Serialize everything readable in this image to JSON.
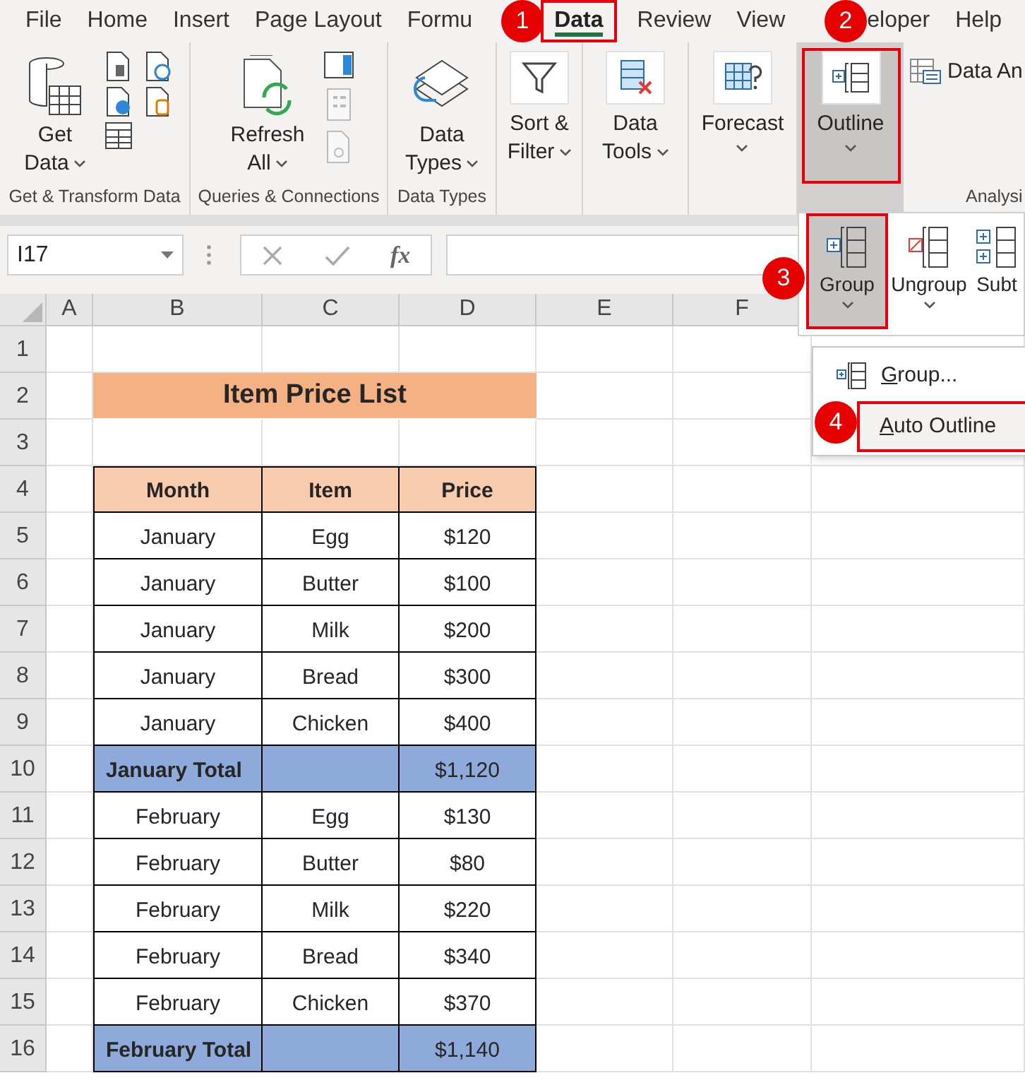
{
  "menu_tabs": [
    {
      "label": "File",
      "selected": false,
      "annotated": false
    },
    {
      "label": "Home",
      "selected": false,
      "annotated": false
    },
    {
      "label": "Insert",
      "selected": false,
      "annotated": false
    },
    {
      "label": "Page Layout",
      "selected": false,
      "annotated": false
    },
    {
      "label": "Formu",
      "selected": false,
      "annotated": false
    },
    {
      "label": "Data",
      "selected": true,
      "annotated": true,
      "callout": "1"
    },
    {
      "label": "Review",
      "selected": false,
      "annotated": false
    },
    {
      "label": "View",
      "selected": false,
      "annotated": false
    },
    {
      "label": "eloper",
      "selected": false,
      "annotated": false
    },
    {
      "label": "Help",
      "selected": false,
      "annotated": false
    }
  ],
  "ribbon": {
    "groups": [
      {
        "kind": "get_transform",
        "label": "Get & Transform Data",
        "button": {
          "lines": [
            "Get",
            "Data"
          ],
          "dropdown": true,
          "pressed": false,
          "annotated": false
        }
      },
      {
        "kind": "queries",
        "label": "Queries & Connections",
        "button": {
          "lines": [
            "Refresh",
            "All"
          ],
          "dropdown": true,
          "pressed": false,
          "annotated": false
        }
      },
      {
        "kind": "data_types",
        "label": "Data Types",
        "button": {
          "lines": [
            "Data",
            "Types"
          ],
          "dropdown": true,
          "pressed": false,
          "annotated": false
        }
      },
      {
        "kind": "sort_filter",
        "button": {
          "lines": [
            "Sort &",
            "Filter"
          ],
          "dropdown": true,
          "pressed": false,
          "annotated": false
        }
      },
      {
        "kind": "data_tools",
        "button": {
          "lines": [
            "Data",
            "Tools"
          ],
          "dropdown": true,
          "pressed": false,
          "annotated": false
        }
      },
      {
        "kind": "forecast",
        "button": {
          "lines": [
            "Forecast"
          ],
          "dropdown": true,
          "pressed": false,
          "annotated": false
        }
      },
      {
        "kind": "outline",
        "button": {
          "lines": [
            "Outline"
          ],
          "dropdown": true,
          "pressed": true,
          "annotated": true,
          "callout": "2"
        }
      },
      {
        "kind": "analysis",
        "label": "Analysi",
        "button": {
          "lines": [
            "Data An"
          ],
          "pressed": false,
          "annotated": false
        }
      }
    ]
  },
  "formula_bar": {
    "name_box": "I17",
    "function_button": "fx"
  },
  "outline_panel": {
    "buttons": [
      {
        "label": "Group",
        "dropdown": true,
        "pressed": true,
        "annotated": true,
        "callout": "3"
      },
      {
        "label": "Ungroup",
        "dropdown": true,
        "pressed": false,
        "annotated": false
      },
      {
        "label": "Subt",
        "dropdown": false,
        "pressed": false,
        "annotated": false
      }
    ],
    "menu": [
      {
        "label": "Group...",
        "highlighted": false,
        "annotated": false
      },
      {
        "label": "Auto Outline",
        "highlighted": true,
        "annotated": true,
        "callout": "4"
      }
    ]
  },
  "sheet": {
    "columns": [
      "A",
      "B",
      "C",
      "D",
      "E",
      "F"
    ],
    "row_numbers": [
      "1",
      "2",
      "3",
      "4",
      "5",
      "6",
      "7",
      "8",
      "9",
      "10",
      "11",
      "12",
      "13",
      "14",
      "15",
      "16"
    ],
    "title": "Item Price List",
    "table": {
      "columns": [
        "Month",
        "Item",
        "Price"
      ],
      "rows": [
        {
          "kind": "item",
          "month": "January",
          "item": "Egg",
          "price": "$120"
        },
        {
          "kind": "item",
          "month": "January",
          "item": "Butter",
          "price": "$100"
        },
        {
          "kind": "item",
          "month": "January",
          "item": "Milk",
          "price": "$200"
        },
        {
          "kind": "item",
          "month": "January",
          "item": "Bread",
          "price": "$300"
        },
        {
          "kind": "item",
          "month": "January",
          "item": "Chicken",
          "price": "$400"
        },
        {
          "kind": "total",
          "label": "January Total",
          "price": "$1,120"
        },
        {
          "kind": "item",
          "month": "February",
          "item": "Egg",
          "price": "$130"
        },
        {
          "kind": "item",
          "month": "February",
          "item": "Butter",
          "price": "$80"
        },
        {
          "kind": "item",
          "month": "February",
          "item": "Milk",
          "price": "$220"
        },
        {
          "kind": "item",
          "month": "February",
          "item": "Bread",
          "price": "$340"
        },
        {
          "kind": "item",
          "month": "February",
          "item": "Chicken",
          "price": "$370"
        },
        {
          "kind": "total",
          "label": "February Total",
          "price": "$1,140"
        }
      ]
    }
  }
}
